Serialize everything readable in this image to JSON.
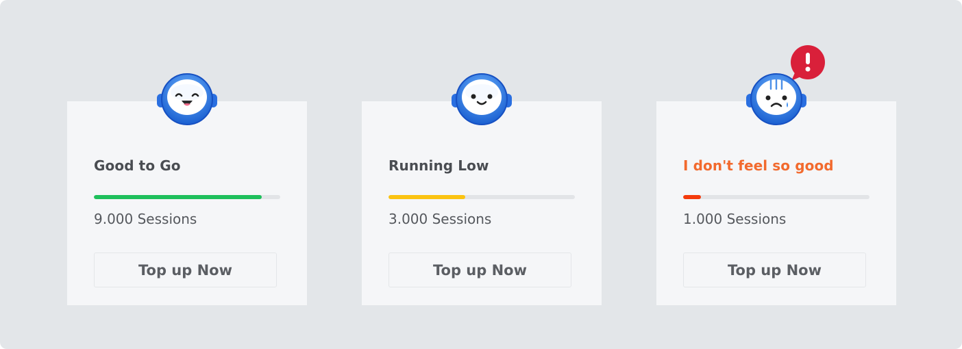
{
  "cards": [
    {
      "title": "Good to Go",
      "sessions": "9.000 Sessions",
      "progress": 0.9,
      "bar_color": "#1ec05c",
      "button_label": "Top up Now",
      "mood": "happy"
    },
    {
      "title": "Running Low",
      "sessions": "3.000 Sessions",
      "progress": 0.41,
      "bar_color": "#fbc311",
      "button_label": "Top up Now",
      "mood": "content"
    },
    {
      "title": "I don't feel so good",
      "sessions": "1.000 Sessions",
      "progress": 0.095,
      "bar_color": "#f43b0c",
      "title_color": "#f26a2e",
      "button_label": "Top up Now",
      "mood": "sad",
      "alert_icon": "exclamation-bubble-icon"
    }
  ],
  "colors": {
    "background": "#e3e6e9",
    "card": "#f5f6f8",
    "robot_blue": "#2f80e4",
    "alert_red": "#d9203a"
  }
}
